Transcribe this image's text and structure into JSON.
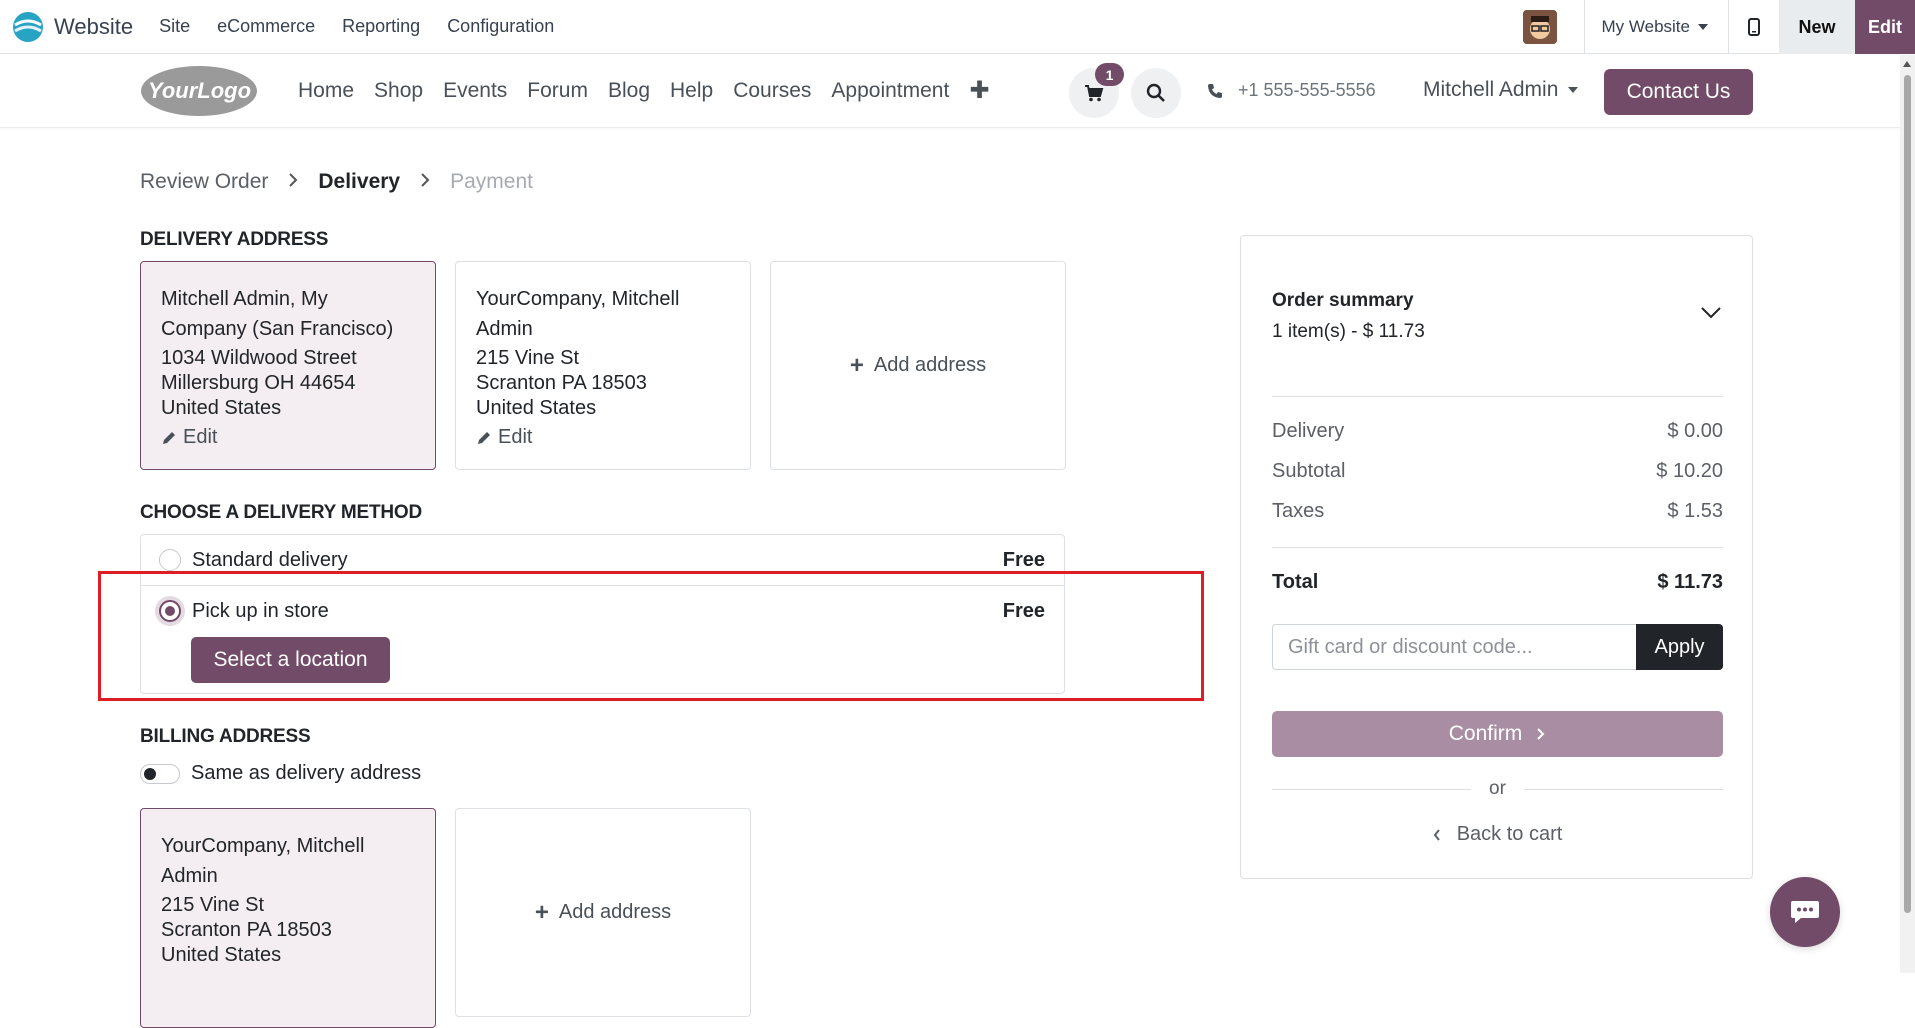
{
  "topbar": {
    "app_name": "Website",
    "menu": [
      "Site",
      "eCommerce",
      "Reporting",
      "Configuration"
    ],
    "website_selector": "My Website",
    "new_label": "New",
    "edit_label": "Edit"
  },
  "navbar": {
    "logo_text": "YourLogo",
    "links": [
      "Home",
      "Shop",
      "Events",
      "Forum",
      "Blog",
      "Help",
      "Courses",
      "Appointment"
    ],
    "cart_count": "1",
    "phone": "+1 555-555-5556",
    "user": "Mitchell Admin",
    "contact_label": "Contact Us"
  },
  "breadcrumb": {
    "step1": "Review Order",
    "step2": "Delivery",
    "step3": "Payment"
  },
  "delivery_address": {
    "title": "DELIVERY ADDRESS",
    "cards": [
      {
        "name": "Mitchell Admin, My Company (San Francisco)",
        "street": "1034 Wildwood Street",
        "city": "Millersburg OH 44654",
        "country": "United States",
        "edit": "Edit"
      },
      {
        "name": "YourCompany, Mitchell Admin",
        "street": "215 Vine St",
        "city": "Scranton PA 18503",
        "country": "United States",
        "edit": "Edit"
      }
    ],
    "add_label": "Add address"
  },
  "delivery_method": {
    "title": "CHOOSE A DELIVERY METHOD",
    "options": [
      {
        "label": "Standard delivery",
        "price": "Free"
      },
      {
        "label": "Pick up in store",
        "price": "Free"
      }
    ],
    "select_location": "Select a location"
  },
  "billing": {
    "title": "BILLING ADDRESS",
    "same_as_label": "Same as delivery address",
    "card": {
      "name": "YourCompany, Mitchell Admin",
      "street": "215 Vine St",
      "city": "Scranton PA 18503",
      "country": "United States"
    },
    "add_label": "Add address"
  },
  "summary": {
    "title": "Order summary",
    "subtitle": "1 item(s) -  $ 11.73",
    "rows": [
      {
        "label": "Delivery",
        "value": "$ 0.00"
      },
      {
        "label": "Subtotal",
        "value": "$ 10.20"
      },
      {
        "label": "Taxes",
        "value": "$ 1.53"
      }
    ],
    "total_label": "Total",
    "total_value": "$ 11.73",
    "coupon_placeholder": "Gift card or discount code...",
    "apply_label": "Apply",
    "confirm_label": "Confirm",
    "or_label": "or",
    "back_label": "Back to cart"
  },
  "colors": {
    "brand": "#714B67",
    "highlight": "#dd1f25"
  }
}
